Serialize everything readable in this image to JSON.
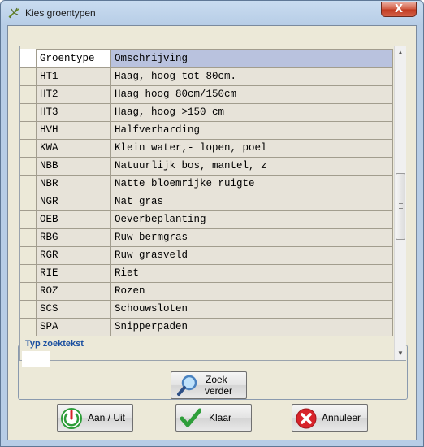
{
  "window": {
    "title": "Kies groentypen",
    "close_symbol": "X"
  },
  "table": {
    "headers": [
      "Groentype",
      "Omschrijving"
    ],
    "rows": [
      {
        "code": "HT1",
        "description": "Haag, hoog tot 80cm."
      },
      {
        "code": "HT2",
        "description": "Haag hoog 80cm/150cm"
      },
      {
        "code": "HT3",
        "description": "Haag, hoog >150 cm"
      },
      {
        "code": "HVH",
        "description": "Halfverharding"
      },
      {
        "code": "KWA",
        "description": "Klein water,- lopen, poel"
      },
      {
        "code": "NBB",
        "description": "Natuurlijk bos, mantel, z"
      },
      {
        "code": "NBR",
        "description": "Natte bloemrijke ruigte"
      },
      {
        "code": "NGR",
        "description": "Nat gras"
      },
      {
        "code": "OEB",
        "description": "Oeverbeplanting"
      },
      {
        "code": "RBG",
        "description": "Ruw bermgras"
      },
      {
        "code": "RGR",
        "description": "Ruw grasveld"
      },
      {
        "code": "RIE",
        "description": "Riet"
      },
      {
        "code": "ROZ",
        "description": "Rozen"
      },
      {
        "code": "SCS",
        "description": "Schouwsloten"
      },
      {
        "code": "SPA",
        "description": "Snipperpaden"
      }
    ]
  },
  "search": {
    "legend": "Typ zoektekst",
    "value": "",
    "button_line1": "Zoek",
    "button_line2": "verder",
    "button_icon": "magnifier-icon"
  },
  "buttons": {
    "aan_uit": {
      "label": "Aan / Uit",
      "icon": "power-icon",
      "color": "#2e9e3a"
    },
    "klaar": {
      "label": "Klaar",
      "icon": "checkmark-icon",
      "color": "#2e9e3a"
    },
    "annuleer": {
      "label": "Annuleer",
      "icon": "cancel-x-icon",
      "color": "#d8232a"
    }
  },
  "colors": {
    "header_selected": "#b9c2de",
    "title_bar": "#c9dcf0",
    "legend_text": "#1a4fa0"
  }
}
